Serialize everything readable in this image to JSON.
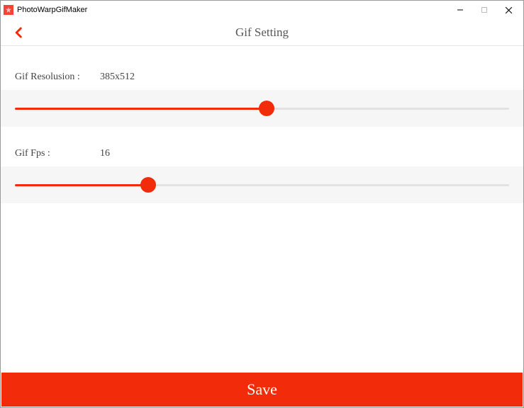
{
  "window": {
    "title": "PhotoWarpGifMaker"
  },
  "header": {
    "title": "Gif Setting"
  },
  "resolution": {
    "label": "Gif Resolusion :",
    "value": "385x512",
    "slider_percent": 51
  },
  "fps": {
    "label": "Gif Fps :",
    "value": "16",
    "slider_percent": 27
  },
  "save": {
    "label": "Save"
  },
  "colors": {
    "accent": "#f22c0a"
  }
}
